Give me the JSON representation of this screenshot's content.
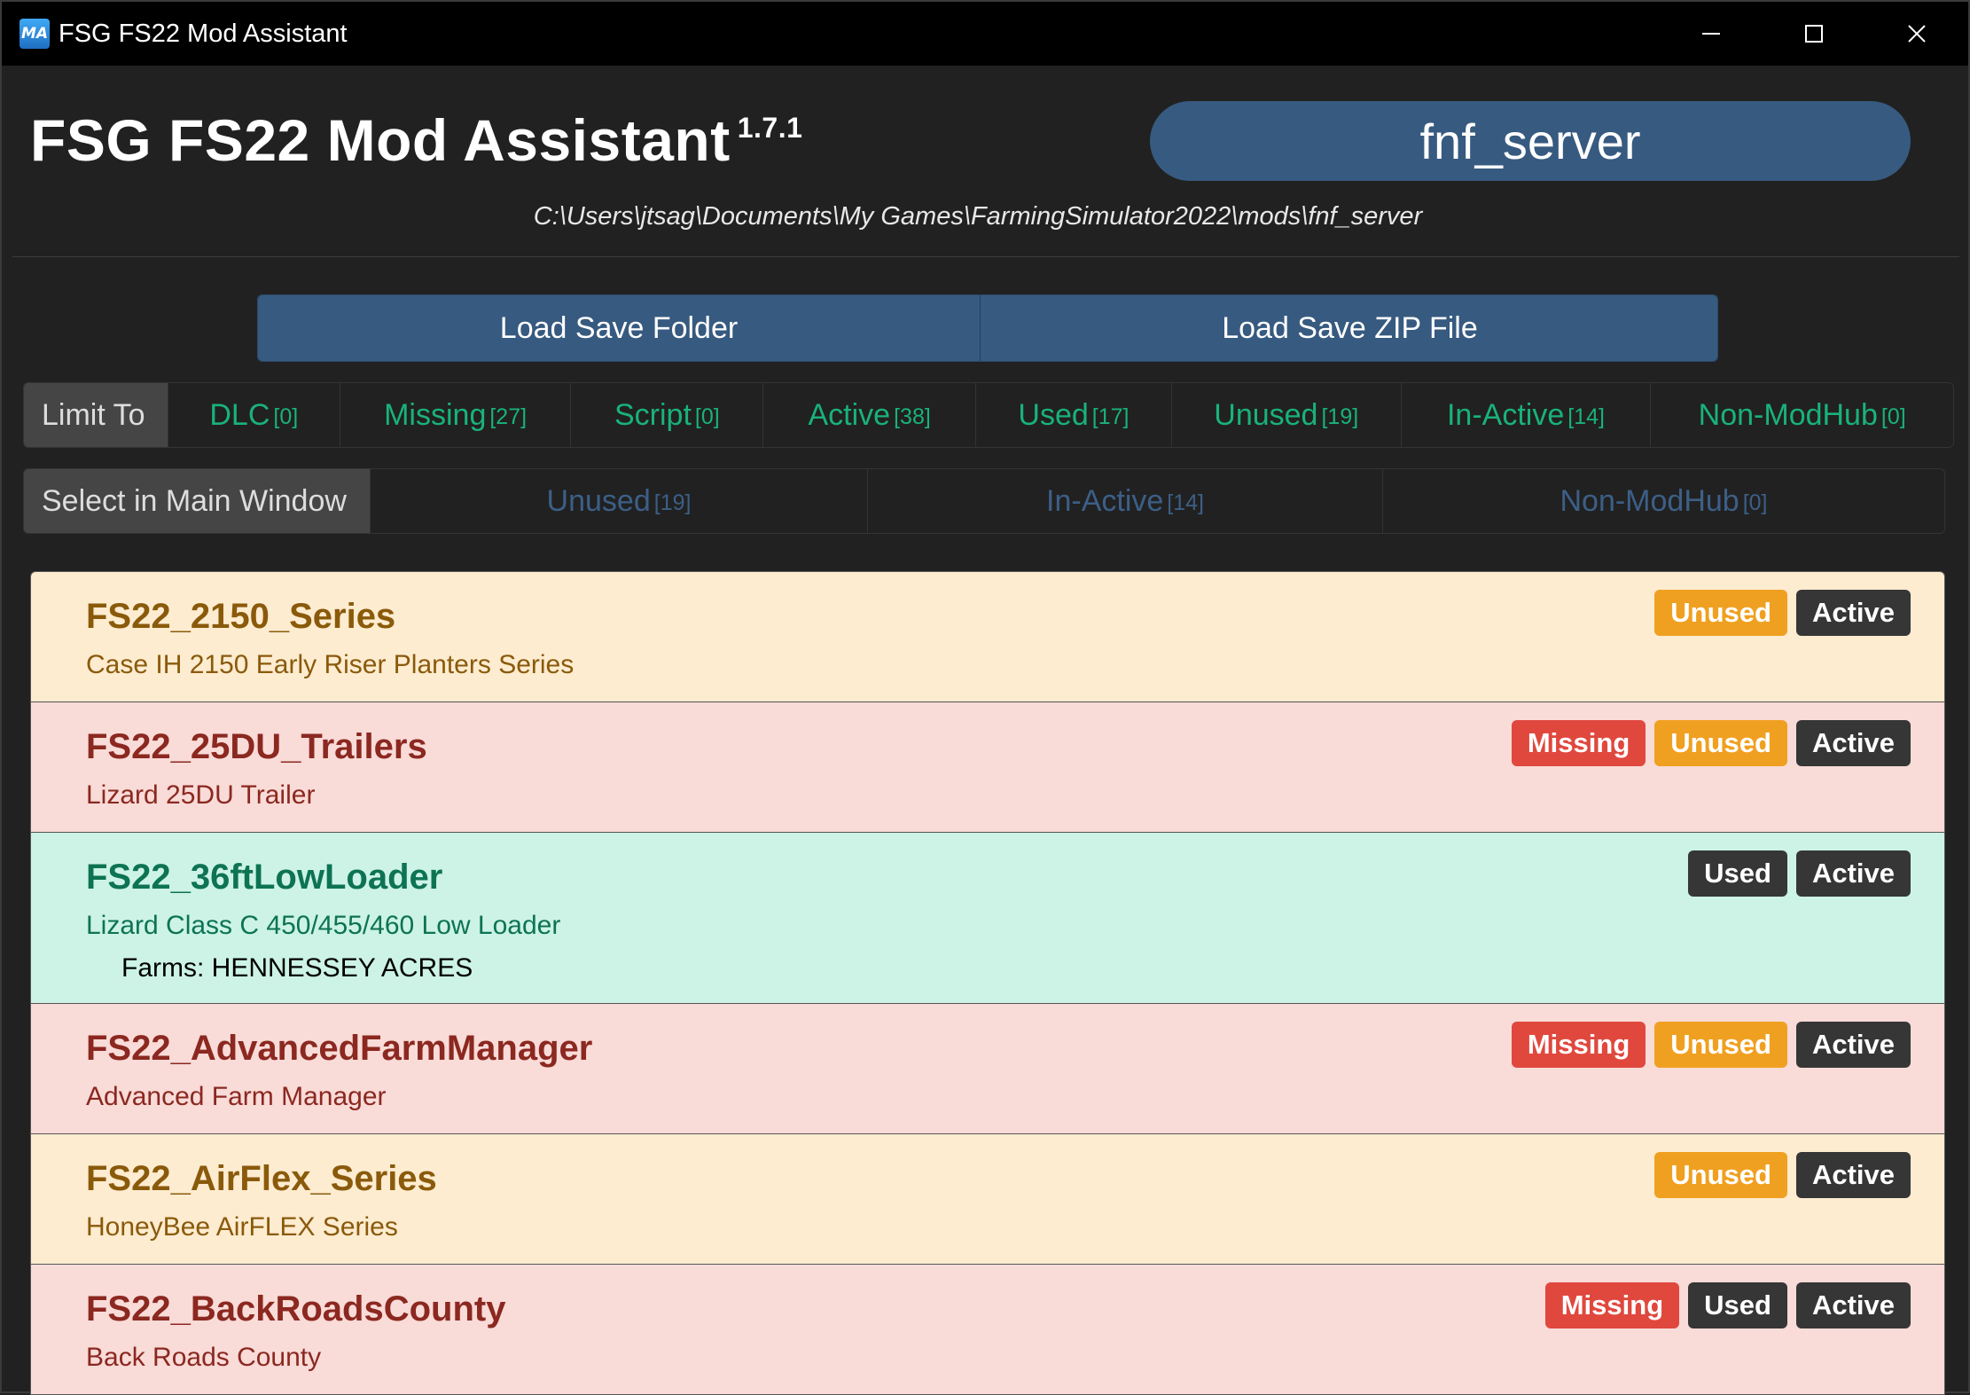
{
  "window": {
    "title": "FSG FS22 Mod Assistant",
    "icon_text": "MA",
    "controls": {
      "minimize": "minimize-icon",
      "maximize": "maximize-icon",
      "close": "close-icon"
    }
  },
  "header": {
    "title": "FSG FS22 Mod Assistant",
    "version": "1.7.1",
    "collection": "fnf_server",
    "path": "C:\\Users\\jtsag\\Documents\\My Games\\FarmingSimulator2022\\mods\\fnf_server"
  },
  "load": {
    "folder_label": "Load Save Folder",
    "zip_label": "Load Save ZIP File"
  },
  "limit": {
    "label": "Limit To",
    "filters": [
      {
        "label": "DLC",
        "count": "[0]"
      },
      {
        "label": "Missing",
        "count": "[27]"
      },
      {
        "label": "Script",
        "count": "[0]"
      },
      {
        "label": "Active",
        "count": "[38]"
      },
      {
        "label": "Used",
        "count": "[17]"
      },
      {
        "label": "Unused",
        "count": "[19]"
      },
      {
        "label": "In-Active",
        "count": "[14]"
      },
      {
        "label": "Non-ModHub",
        "count": "[0]"
      }
    ]
  },
  "select": {
    "label": "Select in Main Window",
    "filters": [
      {
        "label": "Unused",
        "count": "[19]"
      },
      {
        "label": "In-Active",
        "count": "[14]"
      },
      {
        "label": "Non-ModHub",
        "count": "[0]"
      }
    ]
  },
  "colors": {
    "accent": "#375a80",
    "filter_text": "#19b27a",
    "missing": "#e0483e",
    "unused": "#f0a020",
    "dark_badge": "#363636"
  },
  "mods": [
    {
      "name": "FS22_2150_Series",
      "desc": "Case IH 2150 Early Riser Planters Series",
      "farms": "",
      "style": "warning",
      "badges": [
        "Unused",
        "Active"
      ]
    },
    {
      "name": "FS22_25DU_Trailers",
      "desc": "Lizard 25DU Trailer",
      "farms": "",
      "style": "danger",
      "badges": [
        "Missing",
        "Unused",
        "Active"
      ]
    },
    {
      "name": "FS22_36ftLowLoader",
      "desc": "Lizard Class C 450/455/460 Low Loader",
      "farms": "Farms: HENNESSEY ACRES",
      "style": "success",
      "badges": [
        "Used",
        "Active"
      ]
    },
    {
      "name": "FS22_AdvancedFarmManager",
      "desc": "Advanced Farm Manager",
      "farms": "",
      "style": "danger",
      "badges": [
        "Missing",
        "Unused",
        "Active"
      ]
    },
    {
      "name": "FS22_AirFlex_Series",
      "desc": "HoneyBee AirFLEX Series",
      "farms": "",
      "style": "warning",
      "badges": [
        "Unused",
        "Active"
      ]
    },
    {
      "name": "FS22_BackRoadsCounty",
      "desc": "Back Roads County",
      "farms": "",
      "style": "danger",
      "badges": [
        "Missing",
        "Used",
        "Active"
      ]
    }
  ]
}
